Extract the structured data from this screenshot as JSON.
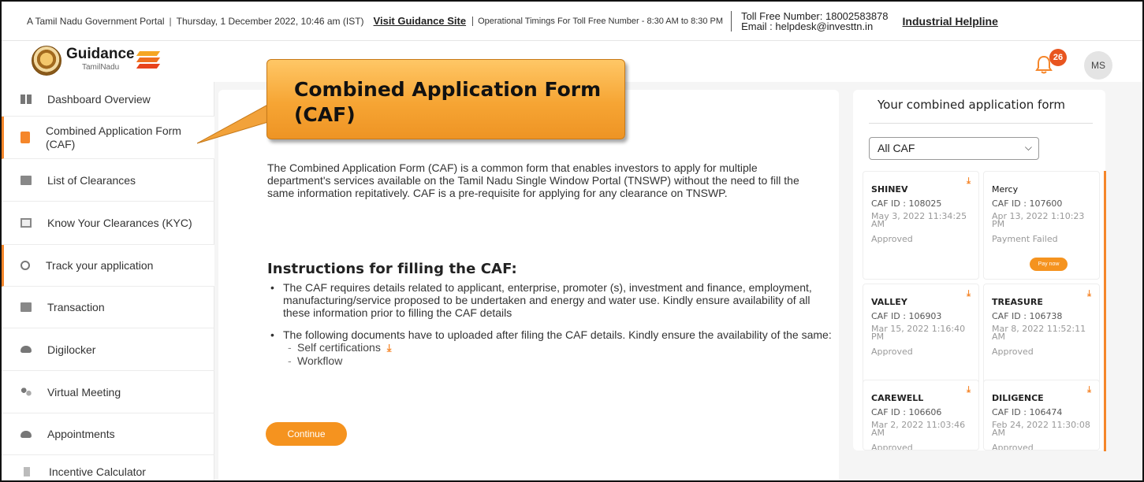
{
  "topbar": {
    "portal": "A Tamil Nadu Government Portal",
    "datetime": "Thursday, 1 December 2022, 10:46 am (IST)",
    "visit_label": "Visit Guidance Site",
    "operational": "Operational Timings For Toll Free Number - 8:30 AM to 8:30 PM",
    "toll": "Toll Free Number: 18002583878",
    "email": "Email : helpdesk@investtn.in",
    "helpline_label": "Industrial Helpline"
  },
  "header": {
    "logo_word": "Guidance",
    "logo_sub": "TamilNadu",
    "notification_count": "26",
    "avatar_initials": "MS"
  },
  "sidebar": {
    "items": [
      {
        "label": "Dashboard Overview",
        "icon": "dashboard-icon"
      },
      {
        "label": "Combined Application Form (CAF)",
        "icon": "document-icon",
        "active": true
      },
      {
        "label": "List of Clearances",
        "icon": "list-icon"
      },
      {
        "label": "Know Your Clearances (KYC)",
        "icon": "book-icon"
      },
      {
        "label": "Track your application",
        "icon": "location-pin-icon"
      },
      {
        "label": "Transaction",
        "icon": "transaction-icon"
      },
      {
        "label": "Digilocker",
        "icon": "cloud-icon"
      },
      {
        "label": "Virtual Meeting",
        "icon": "meeting-icon"
      },
      {
        "label": "Appointments",
        "icon": "cloud-icon"
      },
      {
        "label": "Incentive Calculator",
        "icon": "calculator-icon"
      }
    ]
  },
  "callout": {
    "text": "Combined Application Form (CAF)"
  },
  "main": {
    "description": "The Combined Application Form (CAF) is a common form that enables investors to apply for multiple department's services available on the Tamil Nadu Single Window Portal (TNSWP) without the need to fill the same information repitatively. CAF is a pre-requisite for applying for any clearance on TNSWP.",
    "instructions_title": "Instructions for filling the CAF:",
    "bullet1": "The CAF requires details related to applicant, enterprise, promoter (s), investment and finance, employment, manufacturing/service proposed to be undertaken and energy and water use. Kindly ensure availability of all these information prior to filling the CAF details",
    "bullet2": "The following documents have to uploaded after filing the CAF details. Kindly ensure the availability of the same:",
    "doc1": "Self certifications",
    "doc2": "Workflow",
    "continue_label": "Continue"
  },
  "caf_panel": {
    "title": "Your combined application form",
    "filter_value": "All CAF",
    "cards": [
      {
        "name": "SHINEV",
        "caf_id": "CAF ID : 108025",
        "date": "May 3, 2022 11:34:25 AM",
        "status": "Approved"
      },
      {
        "name": "Mercy",
        "caf_id": "CAF ID : 107600",
        "date": "Apr 13, 2022 1:10:23 PM",
        "status": "Payment Failed",
        "action": "Pay now"
      },
      {
        "name": "VALLEY",
        "caf_id": "CAF ID : 106903",
        "date": "Mar 15, 2022 1:16:40 PM",
        "status": "Approved"
      },
      {
        "name": "TREASURE",
        "caf_id": "CAF ID : 106738",
        "date": "Mar 8, 2022 11:52:11 AM",
        "status": "Approved"
      },
      {
        "name": "CAREWELL",
        "caf_id": "CAF ID : 106606",
        "date": "Mar 2, 2022 11:03:46 AM",
        "status": "Approved"
      },
      {
        "name": "DILIGENCE",
        "caf_id": "CAF ID : 106474",
        "date": "Feb 24, 2022 11:30:08 AM",
        "status": "Approved"
      }
    ]
  },
  "colors": {
    "accent": "#f5862a",
    "callout": "#f6a534",
    "badge": "#e8551f"
  }
}
